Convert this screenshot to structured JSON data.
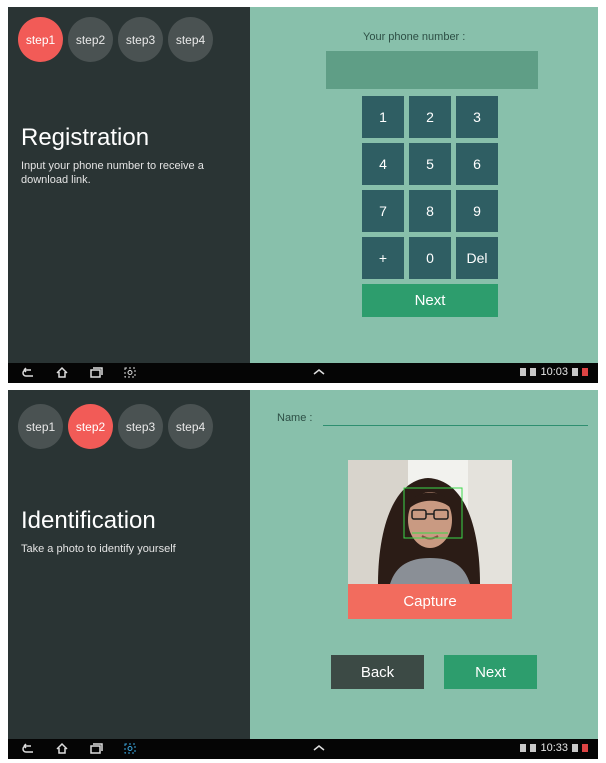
{
  "registration": {
    "steps": [
      "step1",
      "step2",
      "step3",
      "step4"
    ],
    "active_step": 0,
    "title": "Registration",
    "subtitle": "Input your phone number to receive a download link.",
    "phone_label": "Your phone number :",
    "phone_value": "",
    "keys": [
      "1",
      "2",
      "3",
      "4",
      "5",
      "6",
      "7",
      "8",
      "9",
      "+",
      "0",
      "Del"
    ],
    "next_label": "Next",
    "time": "10:03"
  },
  "identification": {
    "steps": [
      "step1",
      "step2",
      "step3",
      "step4"
    ],
    "active_step": 1,
    "title": "Identification",
    "subtitle": "Take a photo to identify yourself",
    "name_label": "Name :",
    "name_value": "",
    "capture_label": "Capture",
    "back_label": "Back",
    "next_label": "Next",
    "time": "10:33"
  },
  "icons": [
    "back-icon",
    "home-icon",
    "recent-apps-icon",
    "screenshot-icon",
    "chevron-up-icon",
    "wifi-icon",
    "signal-icon",
    "battery-icon",
    "camera-preview-icon"
  ],
  "colors": {
    "left_panel": "#2a3434",
    "main_bg": "#88c0ab",
    "active_step": "#f25b57",
    "next_green": "#2d9d6d",
    "capture": "#f26c5e"
  }
}
